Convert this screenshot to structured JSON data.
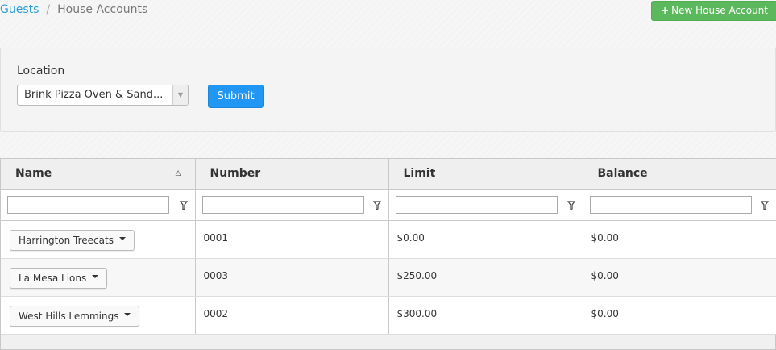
{
  "breadcrumb": {
    "parent": "Guests",
    "separator": "/",
    "current": "House Accounts"
  },
  "header": {
    "new_button_icon": "+",
    "new_button_label": "New House Account",
    "new_button_color": "#5cb85c"
  },
  "filter": {
    "location_label": "Location",
    "location_value": "Brink Pizza Oven & Sand...",
    "submit_label": "Submit",
    "submit_color": "#2196f3"
  },
  "grid": {
    "columns": [
      "Name",
      "Number",
      "Limit",
      "Balance"
    ],
    "sort_column": "Name",
    "sort_icon": "sort-up-triangle-icon",
    "filter_icon": "funnel-icon",
    "rows": [
      {
        "name": "Harrington Treecats",
        "number": "0001",
        "limit": "$0.00",
        "balance": "$0.00"
      },
      {
        "name": "La Mesa Lions",
        "number": "0003",
        "limit": "$250.00",
        "balance": "$0.00"
      },
      {
        "name": "West Hills Lemmings",
        "number": "0002",
        "limit": "$300.00",
        "balance": "$0.00"
      }
    ]
  }
}
